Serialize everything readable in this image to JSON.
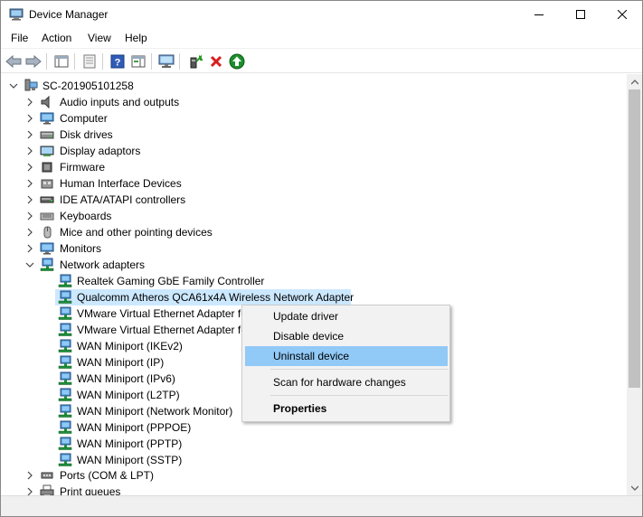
{
  "window": {
    "title": "Device Manager"
  },
  "menu": {
    "file": "File",
    "action": "Action",
    "view": "View",
    "help": "Help"
  },
  "tree": {
    "root": "SC-201905101258",
    "categories": [
      "Audio inputs and outputs",
      "Computer",
      "Disk drives",
      "Display adaptors",
      "Firmware",
      "Human Interface Devices",
      "IDE ATA/ATAPI controllers",
      "Keyboards",
      "Mice and other pointing devices",
      "Monitors",
      "Network adapters"
    ],
    "network_devices": [
      "Realtek Gaming GbE Family Controller",
      "Qualcomm Atheros QCA61x4A Wireless Network Adapter",
      "VMware Virtual Ethernet Adapter fo",
      "VMware Virtual Ethernet Adapter fo",
      "WAN Miniport (IKEv2)",
      "WAN Miniport (IP)",
      "WAN Miniport (IPv6)",
      "WAN Miniport (L2TP)",
      "WAN Miniport (Network Monitor)",
      "WAN Miniport (PPPOE)",
      "WAN Miniport (PPTP)",
      "WAN Miniport (SSTP)"
    ],
    "after_categories": [
      "Ports (COM & LPT)",
      "Print queues"
    ]
  },
  "context_menu": {
    "update": "Update driver",
    "disable": "Disable device",
    "uninstall": "Uninstall device",
    "scan": "Scan for hardware changes",
    "properties": "Properties"
  }
}
